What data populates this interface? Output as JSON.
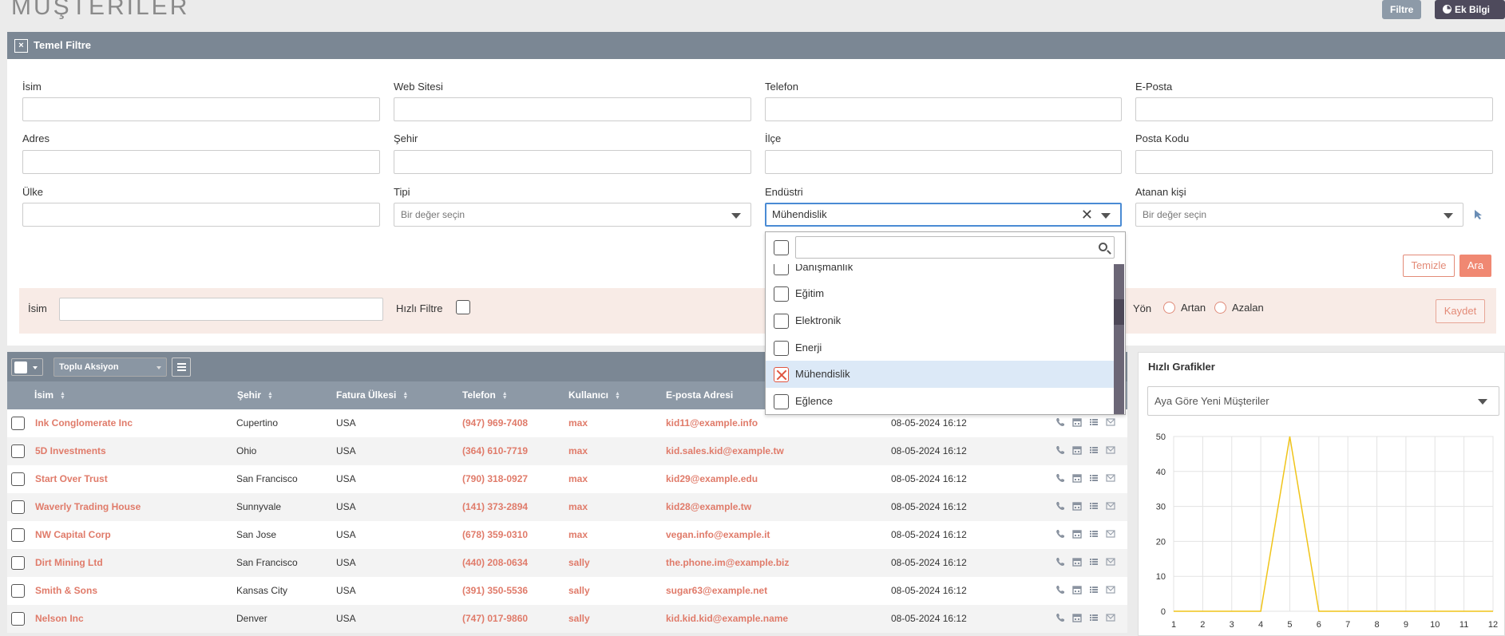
{
  "page": {
    "title": "MUŞTERİLER"
  },
  "header_buttons": {
    "filter": "Filtre",
    "extra_info": "Ek Bilgi"
  },
  "filter": {
    "header": "Temel Filtre",
    "labels": {
      "name": "İsim",
      "website": "Web Sitesi",
      "phone": "Telefon",
      "email": "E-Posta",
      "address": "Adres",
      "city": "Şehir",
      "district": "İlçe",
      "postal_code": "Posta Kodu",
      "country": "Ülke",
      "type": "Tipi",
      "industry": "Endüstri",
      "assignee": "Atanan kişi"
    },
    "placeholders": {
      "select": "Bir değer seçin"
    },
    "industry_value": "Mühendislik",
    "buttons": {
      "clear": "Temizle",
      "search": "Ara"
    }
  },
  "industry_dropdown": {
    "search_value": "",
    "options": [
      {
        "label": "Danışmanlık",
        "selected": false
      },
      {
        "label": "Eğitim",
        "selected": false
      },
      {
        "label": "Elektronik",
        "selected": false
      },
      {
        "label": "Enerji",
        "selected": false
      },
      {
        "label": "Mühendislik",
        "selected": true
      },
      {
        "label": "Eğlence",
        "selected": false
      }
    ]
  },
  "quick_filter": {
    "name_label": "İsim",
    "quick_label": "Hızlı Filtre",
    "direction_label": "Yön",
    "asc": "Artan",
    "desc": "Azalan",
    "save": "Kaydet"
  },
  "table": {
    "bulk_action": "Toplu Aksiyon",
    "columns": [
      "İsim",
      "Şehir",
      "Fatura Ülkesi",
      "Telefon",
      "Kullanıcı",
      "E-posta Adresi"
    ],
    "rows": [
      {
        "name": "Ink Conglomerate Inc",
        "city": "Cupertino",
        "country": "USA",
        "phone": "(947) 969-7408",
        "user": "max",
        "email": "kid11@example.info",
        "date": "08-05-2024 16:12"
      },
      {
        "name": "5D Investments",
        "city": "Ohio",
        "country": "USA",
        "phone": "(364) 610-7719",
        "user": "max",
        "email": "kid.sales.kid@example.tw",
        "date": "08-05-2024 16:12"
      },
      {
        "name": "Start Over Trust",
        "city": "San Francisco",
        "country": "USA",
        "phone": "(790) 318-0927",
        "user": "max",
        "email": "kid29@example.edu",
        "date": "08-05-2024 16:12"
      },
      {
        "name": "Waverly Trading House",
        "city": "Sunnyvale",
        "country": "USA",
        "phone": "(141) 373-2894",
        "user": "max",
        "email": "kid28@example.tw",
        "date": "08-05-2024 16:12"
      },
      {
        "name": "NW Capital Corp",
        "city": "San Jose",
        "country": "USA",
        "phone": "(678) 359-0310",
        "user": "max",
        "email": "vegan.info@example.it",
        "date": "08-05-2024 16:12"
      },
      {
        "name": "Dirt Mining Ltd",
        "city": "San Francisco",
        "country": "USA",
        "phone": "(440) 208-0634",
        "user": "sally",
        "email": "the.phone.im@example.biz",
        "date": "08-05-2024 16:12"
      },
      {
        "name": "Smith & Sons",
        "city": "Kansas City",
        "country": "USA",
        "phone": "(391) 350-5536",
        "user": "sally",
        "email": "sugar63@example.net",
        "date": "08-05-2024 16:12"
      },
      {
        "name": "Nelson Inc",
        "city": "Denver",
        "country": "USA",
        "phone": "(747) 017-9860",
        "user": "sally",
        "email": "kid.kid.kid@example.name",
        "date": "08-05-2024 16:12"
      }
    ]
  },
  "quick_charts": {
    "title": "Hızlı Grafikler",
    "selected_chart": "Aya Göre Yeni Müşteriler"
  },
  "chart_data": {
    "type": "line",
    "x": [
      1,
      2,
      3,
      4,
      5,
      6,
      7,
      8,
      9,
      10,
      11,
      12
    ],
    "series": [
      {
        "values": [
          0,
          0,
          0,
          0,
          50,
          0,
          0,
          0,
          0,
          0,
          0,
          0
        ],
        "color": "#f0c419"
      }
    ],
    "yticks": [
      0,
      10,
      20,
      30,
      40,
      50
    ],
    "ylim": [
      0,
      50
    ],
    "grid": true
  },
  "colors": {
    "accent": "#e07b6a",
    "header_gray": "#7b8794",
    "line": "#f0c419"
  }
}
